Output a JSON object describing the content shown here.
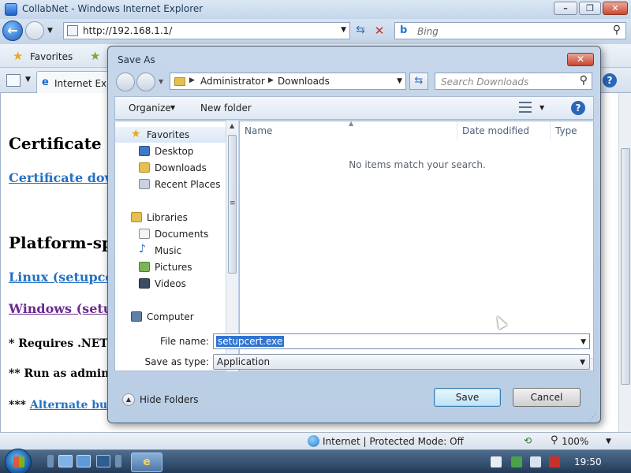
{
  "ie": {
    "window_title": "CollabNet - Windows Internet Explorer",
    "url": "http://192.168.1.1/",
    "search_placeholder": "Bing",
    "favorites_label": "Favorites",
    "tab_label": "Internet Explo",
    "status_zone": "Internet | Protected Mode: Off",
    "zoom": "100%"
  },
  "page": {
    "heading_certificate": "Certificate",
    "link_certificate": "Certificate dow",
    "heading_platform": "Platform-spe",
    "link_linux": "Linux (setupcert",
    "link_windows": "Windows (setup",
    "note1": "* Requires .NET F",
    "note2": "** Run as administ",
    "note3_prefix": "*** ",
    "note3_link": "Alternate build"
  },
  "dialog": {
    "title": "Save As",
    "breadcrumb": [
      "Administrator",
      "Downloads"
    ],
    "search_placeholder": "Search Downloads",
    "organize_label": "Organize",
    "new_folder_label": "New folder",
    "nav": {
      "favorites_header": "Favorites",
      "favorites": [
        "Desktop",
        "Downloads",
        "Recent Places"
      ],
      "libraries_header": "Libraries",
      "libraries": [
        "Documents",
        "Music",
        "Pictures",
        "Videos"
      ],
      "computer_header": "Computer"
    },
    "columns": [
      "Name",
      "Date modified",
      "Type"
    ],
    "empty_message": "No items match your search.",
    "file_name_label": "File name:",
    "file_name_value": "setupcert.exe",
    "save_as_type_label": "Save as type:",
    "save_as_type_value": "Application",
    "hide_folders_label": "Hide Folders",
    "save_label": "Save",
    "cancel_label": "Cancel"
  },
  "taskbar": {
    "clock": "19:50"
  },
  "colors": {
    "link": "#2471c5",
    "visited_link": "#6b2a8f",
    "selection": "#3174d0"
  }
}
